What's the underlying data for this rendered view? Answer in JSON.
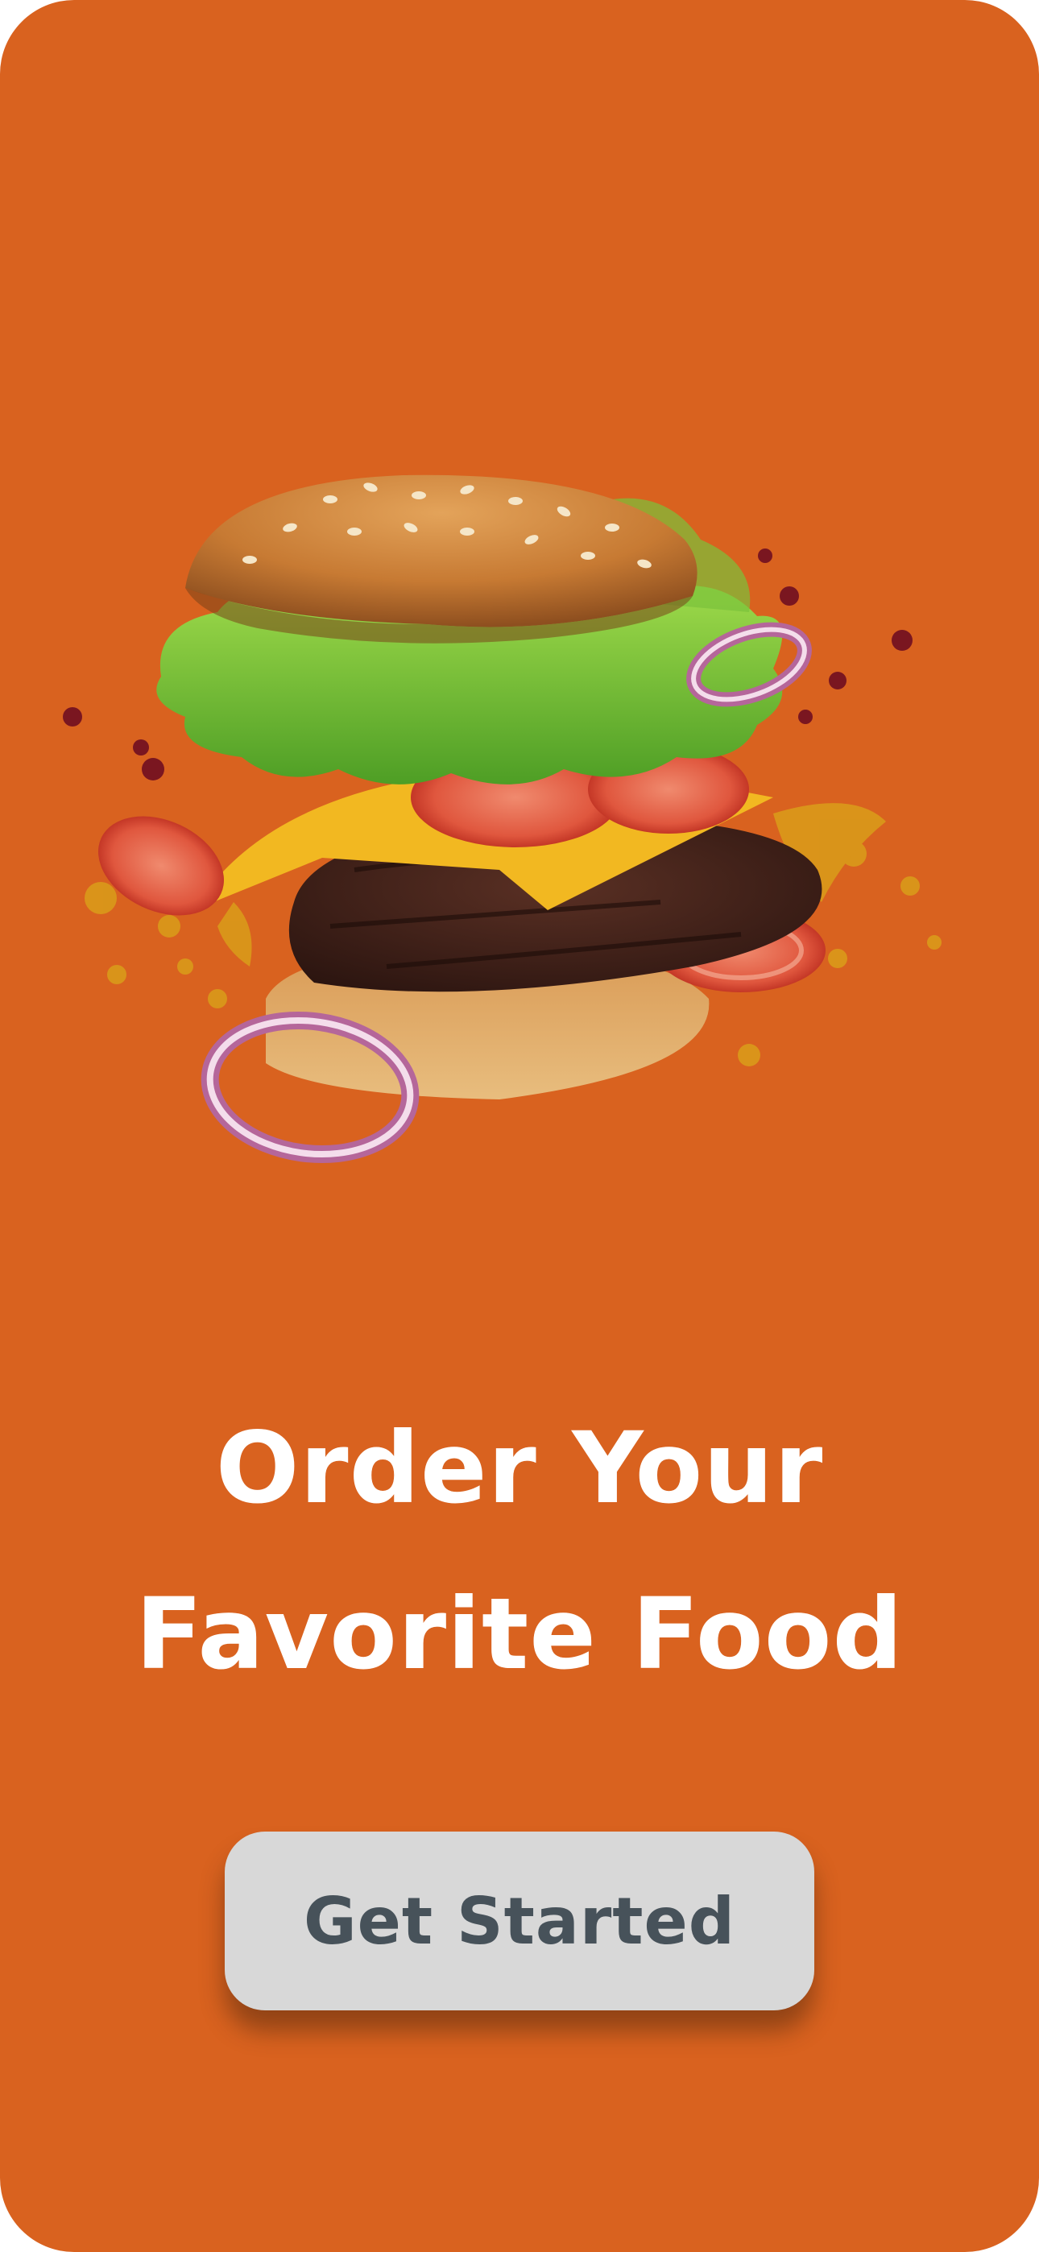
{
  "theme": {
    "background": "#D9621F",
    "button_bg": "#D8D8D8",
    "button_text": "#47525A",
    "headline_color": "#FFFFFF"
  },
  "hero": {
    "illustration": "burger-illustration"
  },
  "headline": {
    "line1": "Order Your",
    "line2": "Favorite Food"
  },
  "cta": {
    "label": "Get Started"
  }
}
